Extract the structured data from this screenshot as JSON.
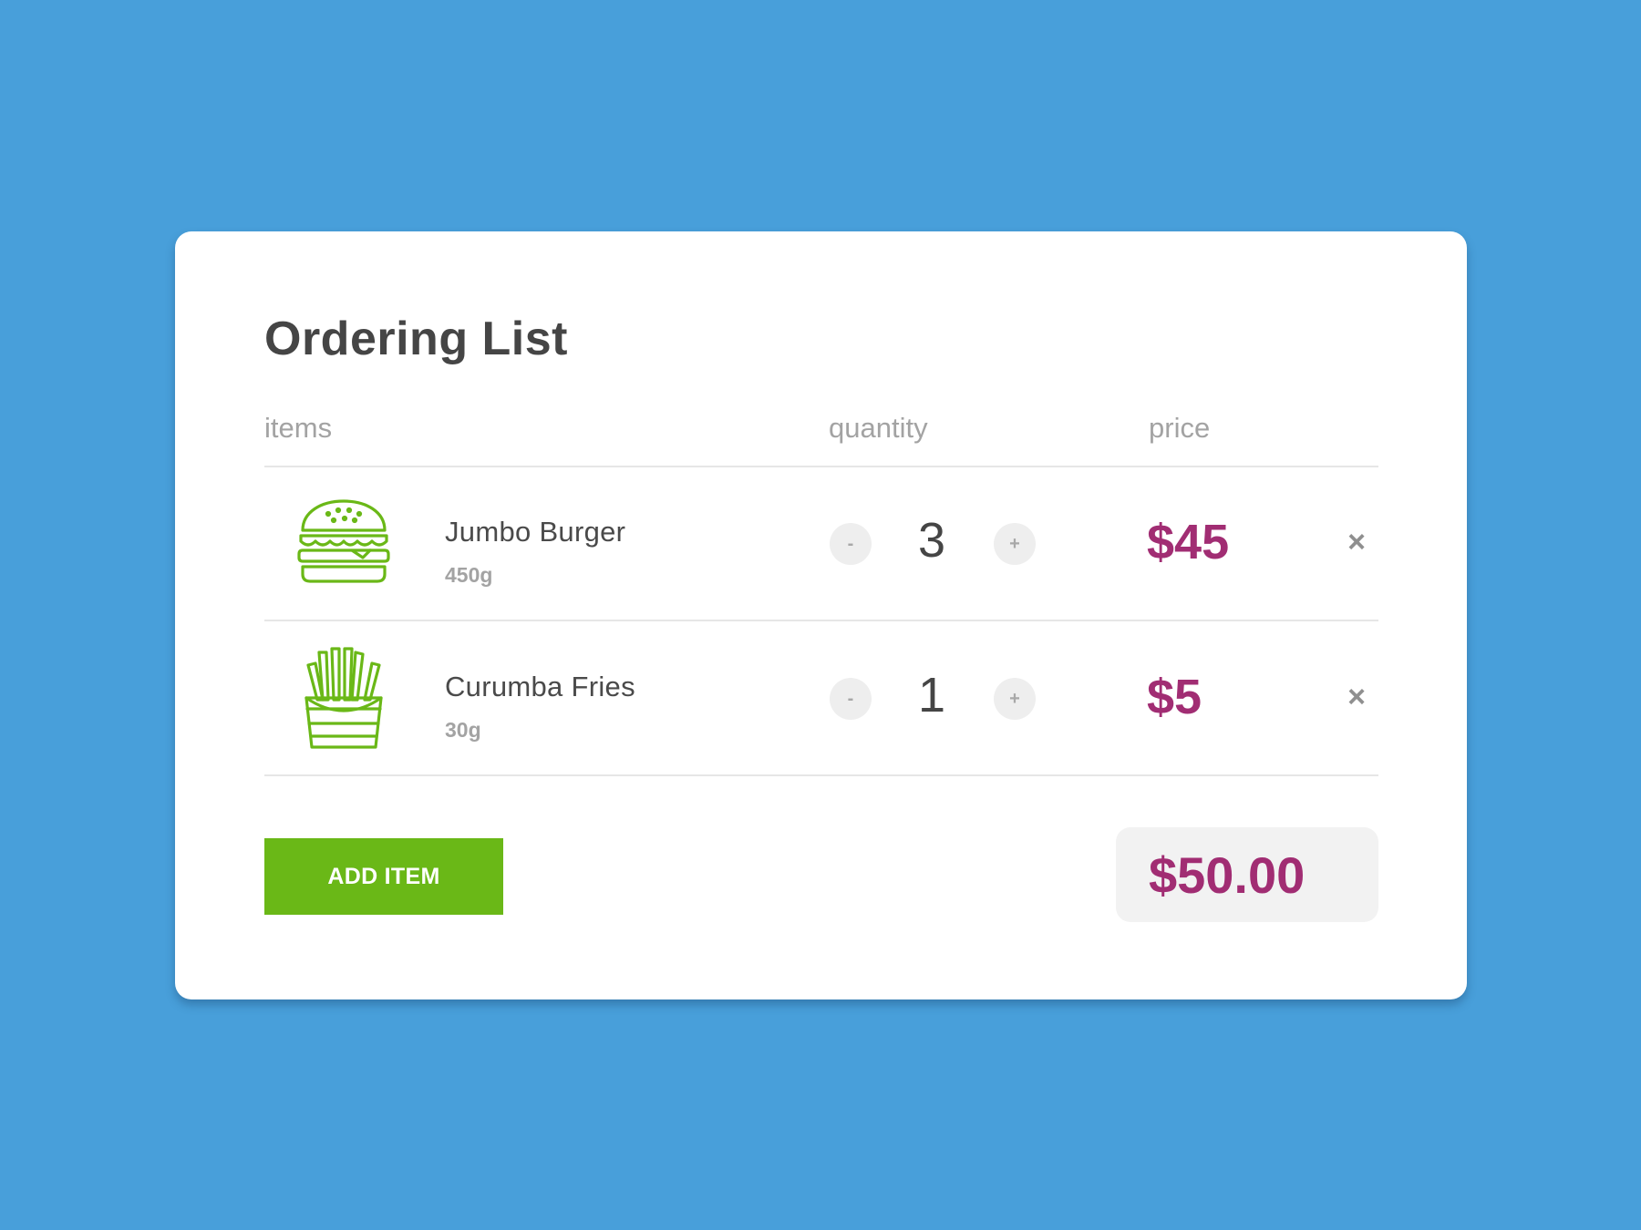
{
  "page": {
    "title": "Ordering List"
  },
  "columns": {
    "items": "items",
    "quantity": "quantity",
    "price": "price"
  },
  "items": [
    {
      "name": "Jumbo Burger",
      "weight": "450g",
      "quantity": "3",
      "price": "$45",
      "icon": "burger-icon"
    },
    {
      "name": "Curumba Fries",
      "weight": "30g",
      "quantity": "1",
      "price": "$5",
      "icon": "fries-icon"
    }
  ],
  "controls": {
    "decrement": "-",
    "increment": "+",
    "remove": "×"
  },
  "footer": {
    "add_item_label": "ADD ITEM",
    "total": "$50.00"
  },
  "colors": {
    "background": "#489fda",
    "accent_green": "#6ab817",
    "price_purple": "#a12d73"
  }
}
